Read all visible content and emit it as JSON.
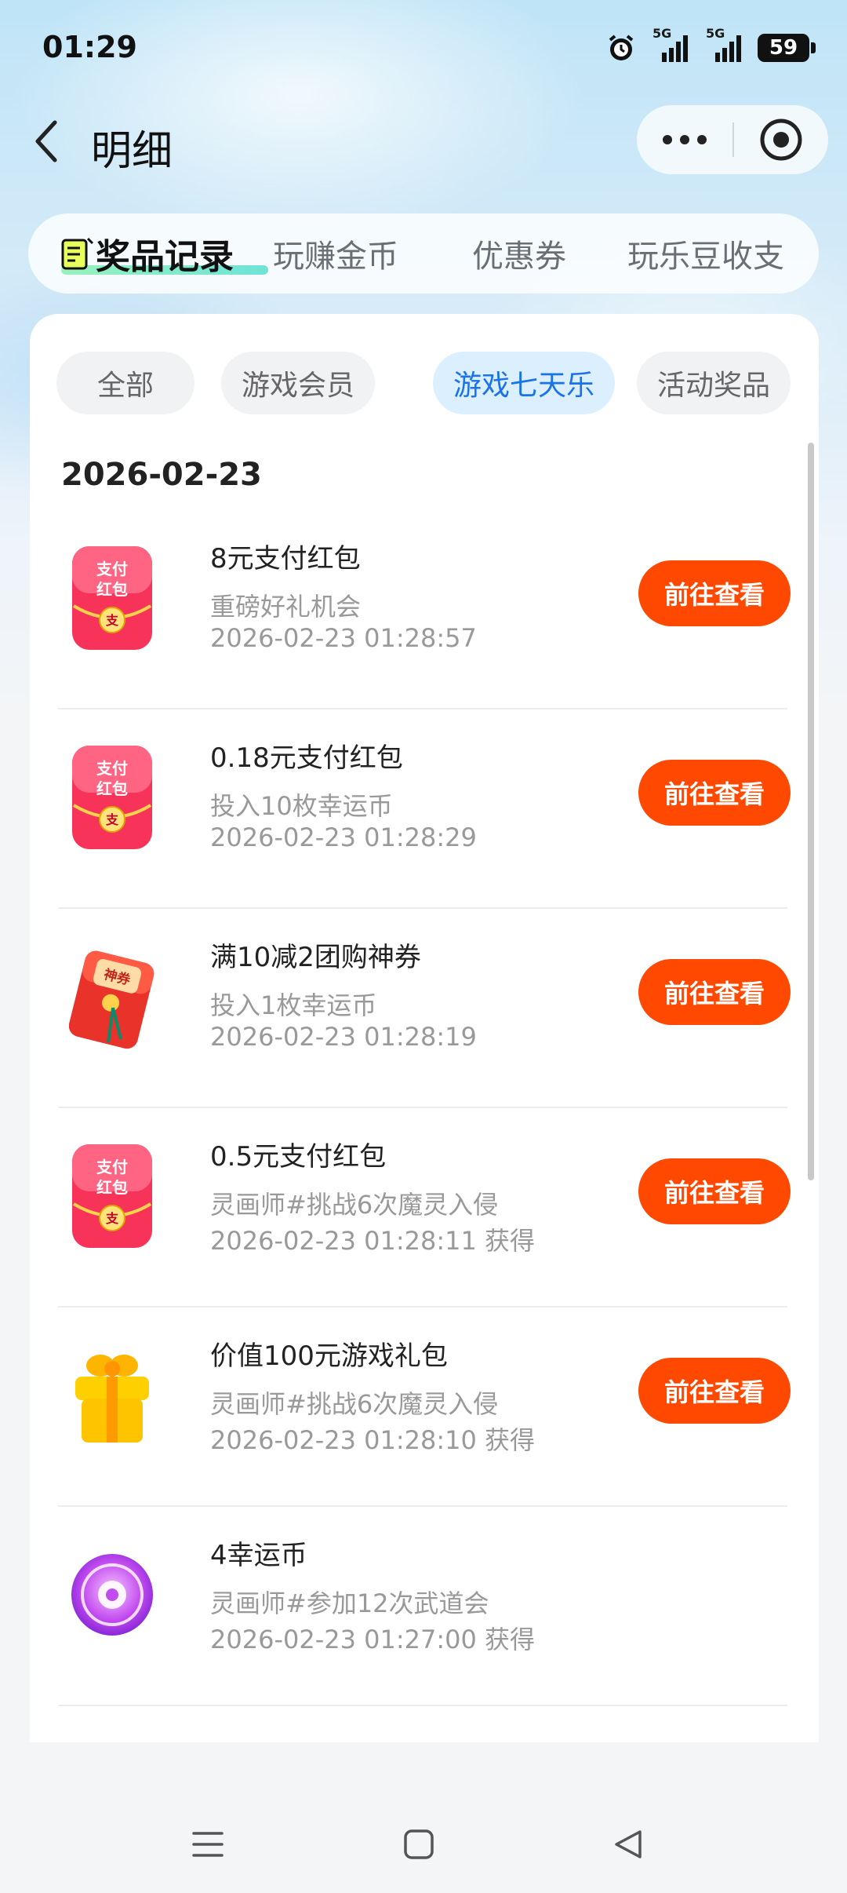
{
  "status_bar": {
    "time": "01:29",
    "battery_level": "59",
    "signal_1_label": "5G",
    "signal_2_label": "5G",
    "icons": [
      "alarm-icon",
      "signal-5g-icon",
      "signal-5g-icon",
      "battery-icon"
    ]
  },
  "header": {
    "title": "明细",
    "back_icon": "chevron-left-icon",
    "more_icon": "more-dots-icon",
    "close_icon": "target-circle-icon"
  },
  "top_tabs": [
    {
      "label": "奖品记录",
      "active": true
    },
    {
      "label": "玩赚金币",
      "active": false
    },
    {
      "label": "优惠券",
      "active": false
    },
    {
      "label": "玩乐豆收支",
      "active": false
    }
  ],
  "filter_chips": [
    {
      "label": "全部",
      "active": false
    },
    {
      "label": "游戏会员",
      "active": false
    },
    {
      "label": "游戏七天乐",
      "active": true
    },
    {
      "label": "活动奖品",
      "active": false
    }
  ],
  "date_group": "2026-02-23",
  "records": [
    {
      "title": "8元支付红包",
      "subtitle": "重磅好礼机会",
      "time": "2026-02-23 01:28:57",
      "button": "前往查看",
      "icon": "red-packet-icon"
    },
    {
      "title": "0.18元支付红包",
      "subtitle": "投入10枚幸运币",
      "time": "2026-02-23 01:28:29",
      "button": "前往查看",
      "icon": "red-packet-icon"
    },
    {
      "title": "满10减2团购神券",
      "subtitle": "投入1枚幸运币",
      "time": "2026-02-23 01:28:19",
      "button": "前往查看",
      "icon": "coupon-envelope-icon"
    },
    {
      "title": "0.5元支付红包",
      "subtitle": "灵画师#挑战6次魔灵入侵",
      "time": "2026-02-23 01:28:11 获得",
      "button": "前往查看",
      "icon": "red-packet-icon"
    },
    {
      "title": "价值100元游戏礼包",
      "subtitle": "灵画师#挑战6次魔灵入侵",
      "time": "2026-02-23 01:28:10 获得",
      "button": "前往查看",
      "icon": "gift-box-icon"
    },
    {
      "title": "4幸运币",
      "subtitle": "灵画师#参加12次武道会",
      "time": "2026-02-23 01:27:00 获得",
      "button": "",
      "icon": "lucky-coin-icon"
    }
  ],
  "red_packet_text": {
    "line1": "支付",
    "line2": "红包",
    "seal": "支"
  },
  "coupon_text": {
    "badge": "神券"
  },
  "nav_bar": {
    "icons": [
      "menu-icon",
      "home-square-icon",
      "back-triangle-icon"
    ]
  },
  "colors": {
    "accent_button": "#ff4800",
    "active_chip_bg": "#dcefff",
    "active_chip_text": "#1a73e8"
  }
}
